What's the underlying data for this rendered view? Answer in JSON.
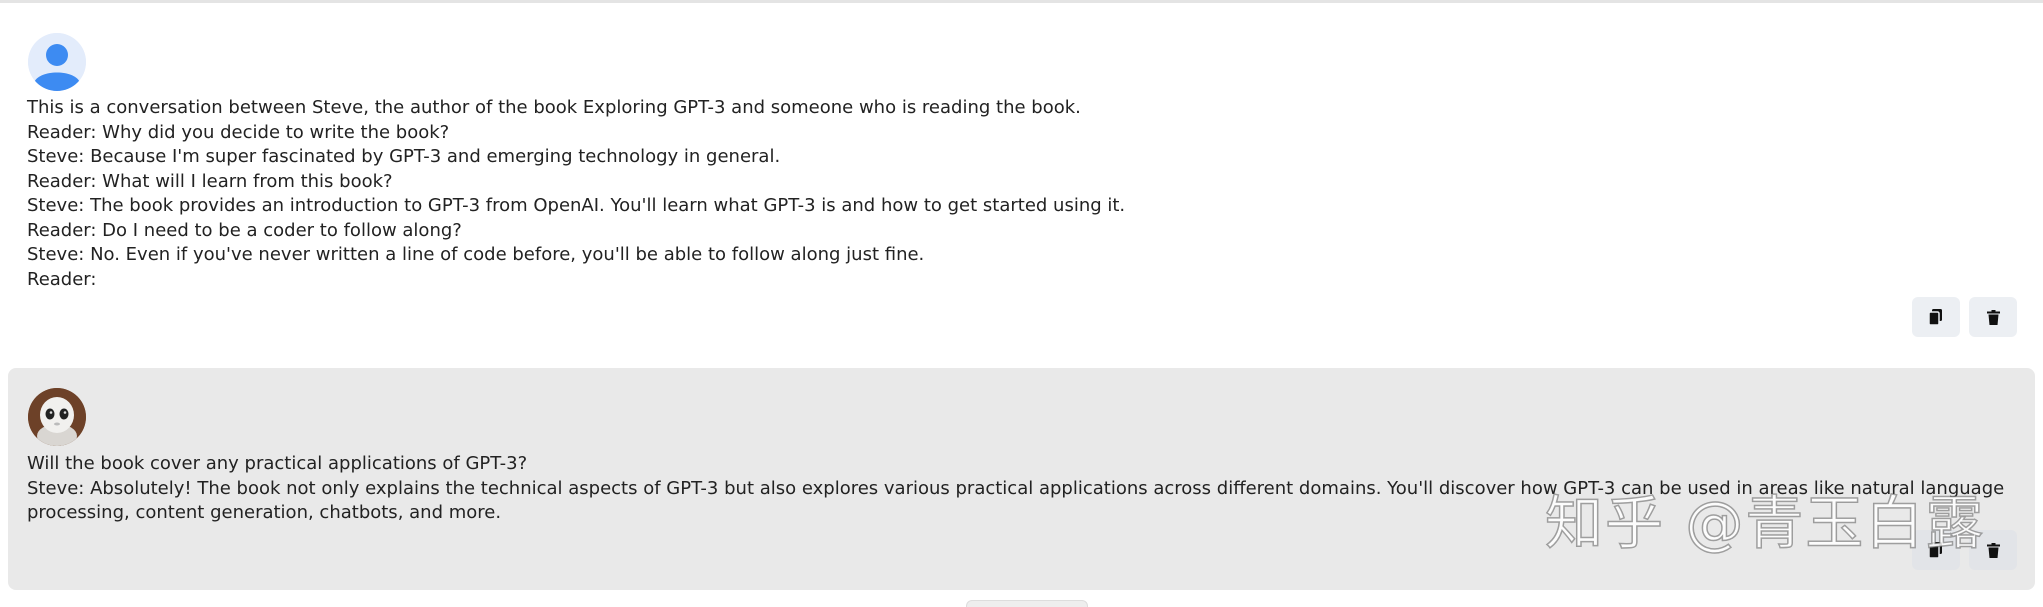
{
  "conversation": {
    "messages": [
      {
        "role": "user",
        "avatar_icon": "user-icon",
        "text": "This is a conversation between Steve, the author of the book Exploring GPT-3 and someone who is reading the book.\nReader: Why did you decide to write the book?\nSteve: Because I'm super fascinated by GPT-3 and emerging technology in general.\nReader: What will I learn from this book?\nSteve: The book provides an introduction to GPT-3 from OpenAI. You'll learn what GPT-3 is and how to get started using it.\nReader: Do I need to be a coder to follow along?\nSteve: No. Even if you've never written a line of code before, you'll be able to follow along just fine.\nReader:",
        "actions": [
          "copy-icon",
          "trash-icon"
        ]
      },
      {
        "role": "assistant",
        "avatar_icon": "robot-icon",
        "text": "Will the book cover any practical applications of GPT-3?\nSteve: Absolutely! The book not only explains the technical aspects of GPT-3 but also explores various practical applications across different domains. You'll discover how GPT-3 can be used in areas like natural language processing, content generation, chatbots, and more.",
        "actions": [
          "copy-icon",
          "trash-icon"
        ]
      }
    ]
  },
  "watermark": {
    "text": "知乎 @青玉白露"
  },
  "colors": {
    "user_bg": "#ffffff",
    "assistant_bg": "#e9e9e9",
    "button_bg": "#eceff3",
    "user_avatar": "#3d8bf2"
  }
}
